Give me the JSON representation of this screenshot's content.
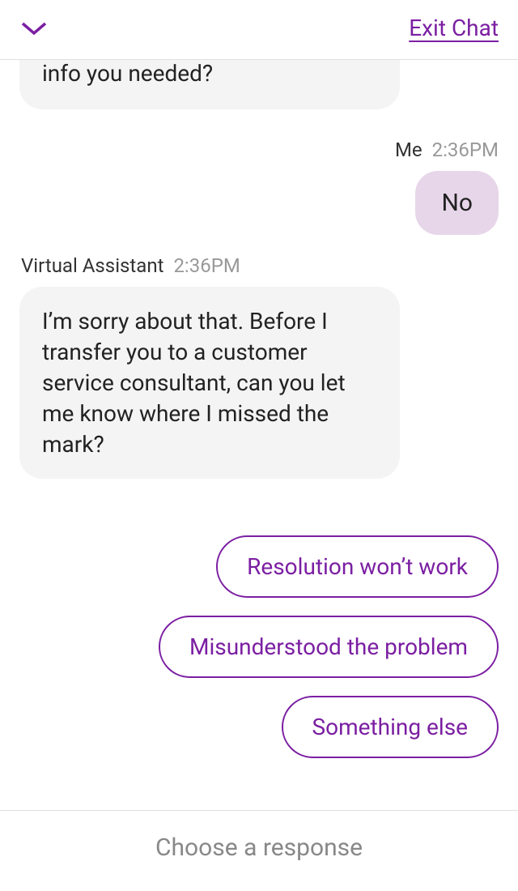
{
  "header": {
    "exit_label": "Exit Chat"
  },
  "messages": {
    "va_partial": "info you needed?",
    "me_sender": "Me",
    "me_time": "2:36PM",
    "me_text": "No",
    "va_sender": "Virtual Assistant",
    "va_time": "2:36PM",
    "va_text": "I’m sorry about that. Before I transfer you to a customer service consultant, can you let me know where I missed the mark?"
  },
  "quick_replies": [
    "Resolution won’t work",
    "Misunderstood the problem",
    "Something else"
  ],
  "footer": {
    "prompt": "Choose a response"
  }
}
